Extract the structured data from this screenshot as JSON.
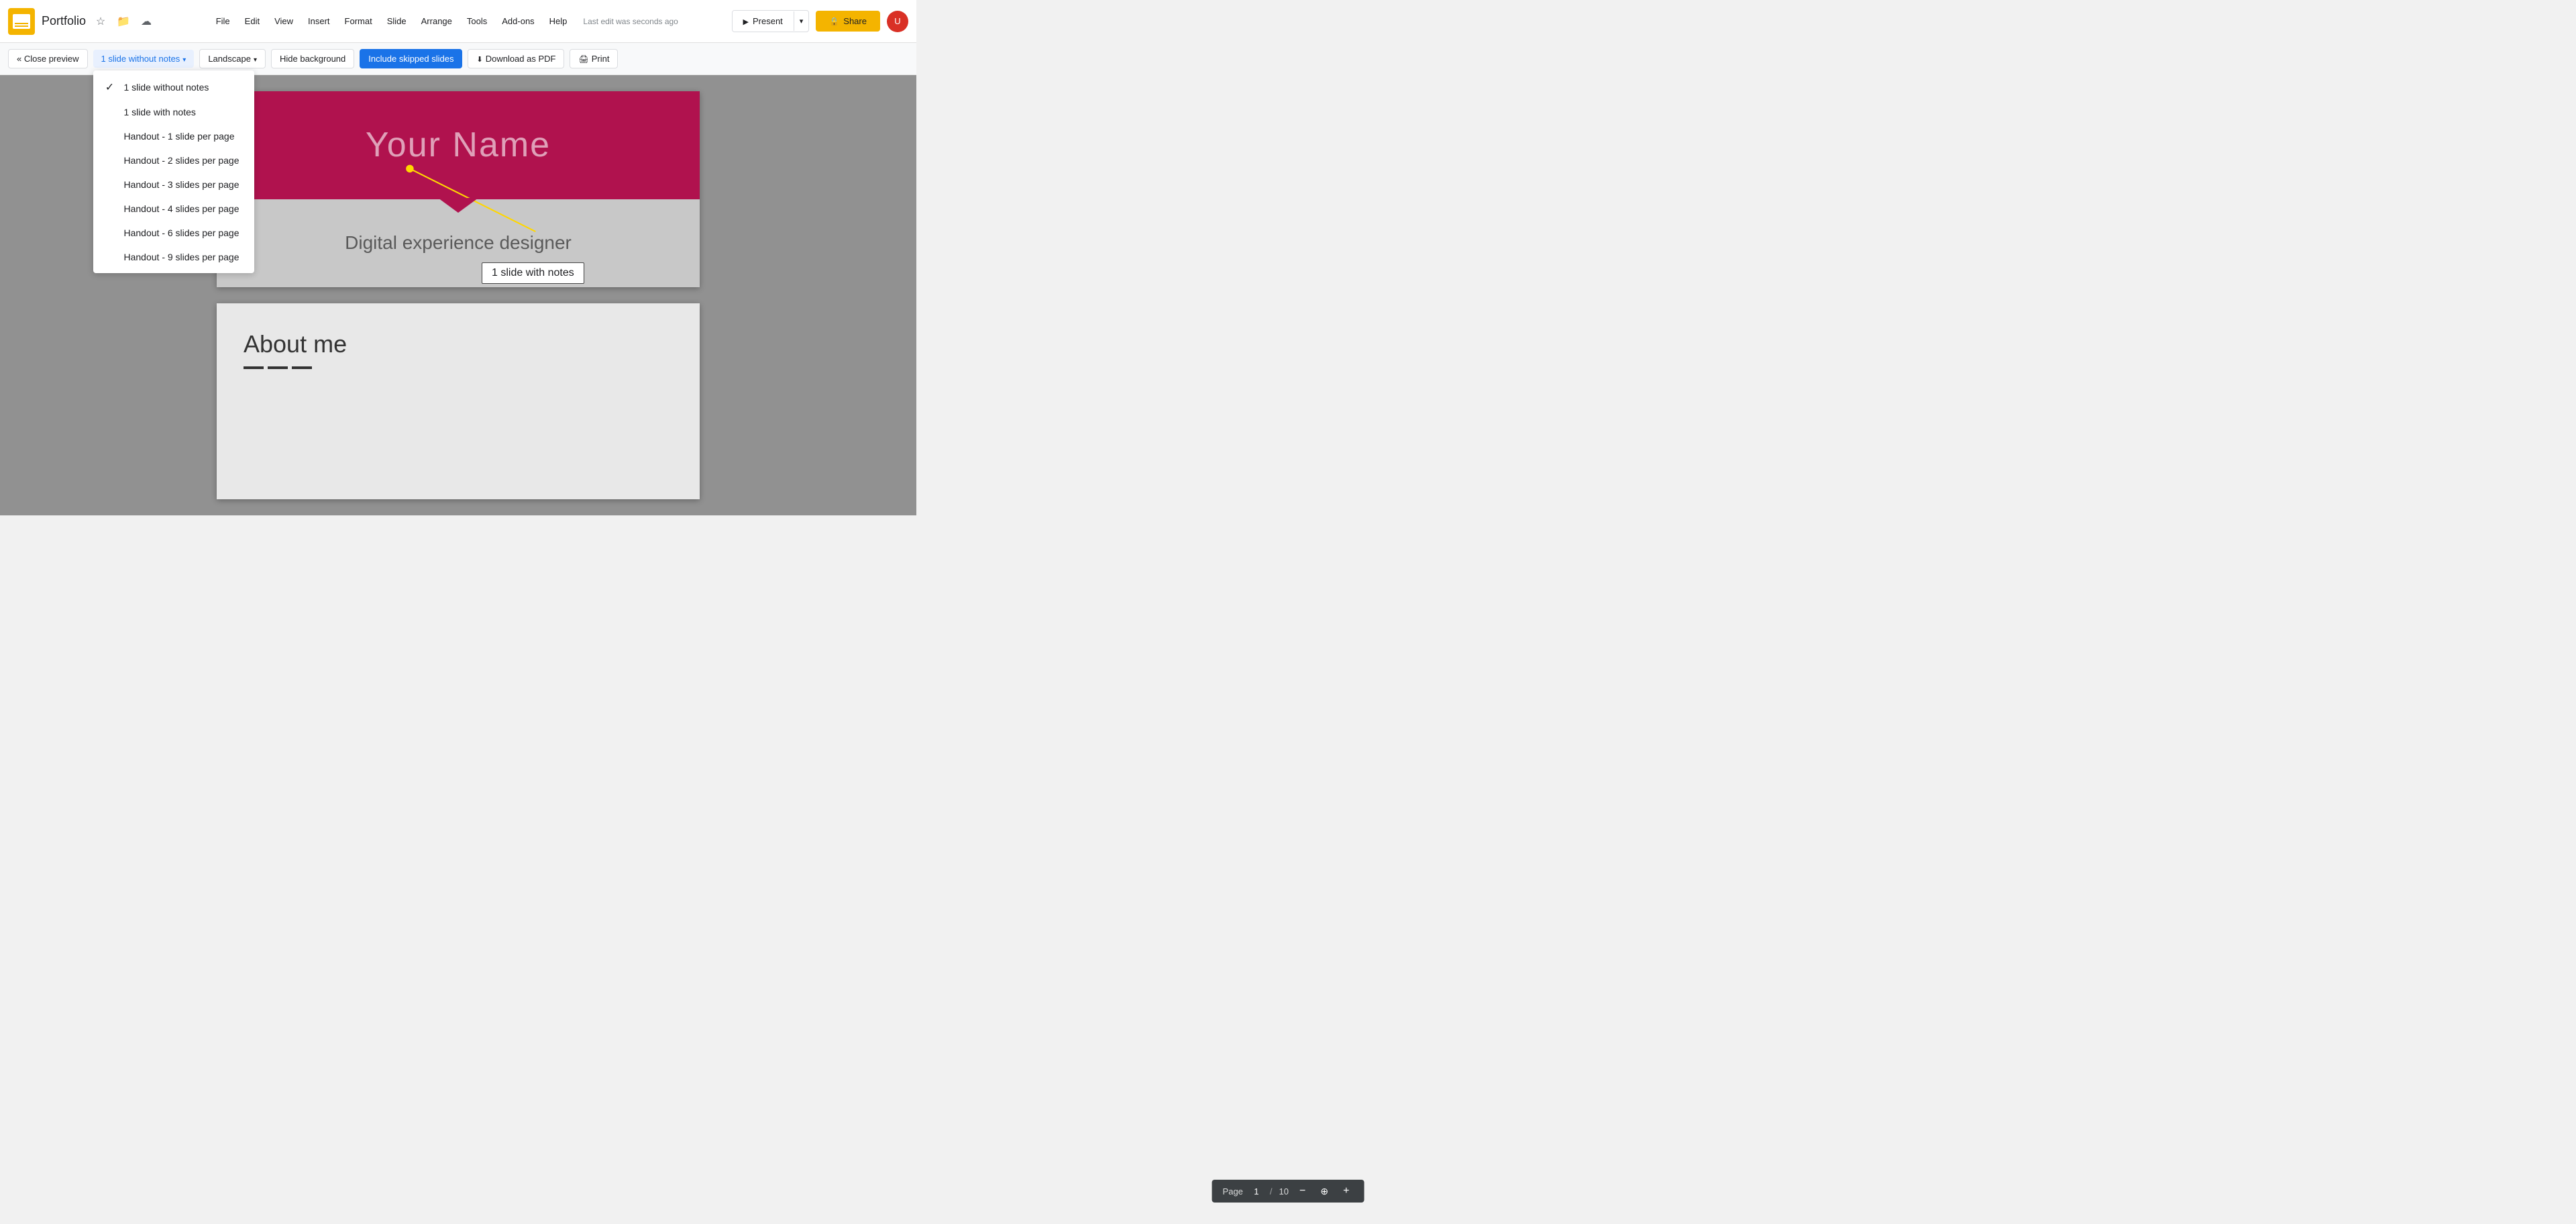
{
  "app": {
    "icon_label": "Slides icon",
    "doc_title": "Portfolio",
    "star_label": "Star",
    "folder_label": "Move to folder",
    "cloud_label": "Cloud save status"
  },
  "menubar": {
    "items": [
      "File",
      "Edit",
      "View",
      "Insert",
      "Format",
      "Slide",
      "Arrange",
      "Tools",
      "Add-ons",
      "Help"
    ]
  },
  "last_edit": "Last edit was seconds ago",
  "header_right": {
    "present_label": "Present",
    "share_label": "Share"
  },
  "toolbar": {
    "close_preview": "« Close preview",
    "layout_btn": "1 slide without notes",
    "orientation": "Landscape",
    "hide_background": "Hide background",
    "include_skipped": "Include skipped slides",
    "download_pdf": "Download as PDF",
    "print": "Print"
  },
  "layout_dropdown": {
    "items": [
      {
        "id": "1-slide-without-notes",
        "label": "1 slide without notes",
        "checked": true
      },
      {
        "id": "1-slide-with-notes",
        "label": "1 slide with notes",
        "checked": false
      },
      {
        "id": "handout-1",
        "label": "Handout - 1 slide per page",
        "checked": false
      },
      {
        "id": "handout-2",
        "label": "Handout - 2 slides per page",
        "checked": false
      },
      {
        "id": "handout-3",
        "label": "Handout - 3 slides per page",
        "checked": false
      },
      {
        "id": "handout-4",
        "label": "Handout - 4 slides per page",
        "checked": false
      },
      {
        "id": "handout-6",
        "label": "Handout - 6 slides per page",
        "checked": false
      },
      {
        "id": "handout-9",
        "label": "Handout - 9 slides per page",
        "checked": false
      }
    ]
  },
  "slide1": {
    "title": "Your Name",
    "subtitle": "Digital experience designer"
  },
  "slide2": {
    "title": "About me"
  },
  "annotation": {
    "callout_text": "1 slide with notes"
  },
  "page_nav": {
    "label": "Page",
    "current": "1",
    "separator": "/",
    "total": "10",
    "minus_label": "Previous page",
    "zoom_label": "Zoom",
    "plus_label": "Next page"
  }
}
